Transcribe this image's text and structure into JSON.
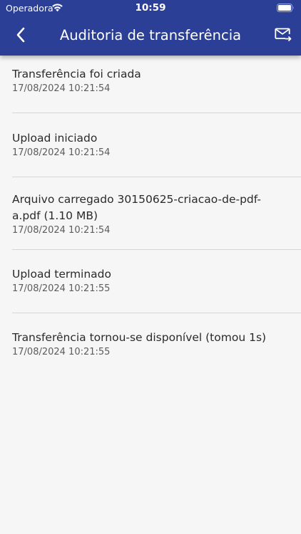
{
  "status_bar": {
    "carrier": "Operadora",
    "time": "10:59"
  },
  "nav": {
    "title": "Auditoria de transferência",
    "back_icon": "chevron-left-icon",
    "mail_icon": "mail-forward-icon"
  },
  "colors": {
    "header": "#2c3f96",
    "background": "#f6f6f6",
    "divider": "#d6d6d6"
  },
  "events": [
    {
      "title": "Transferência foi criada",
      "time": "17/08/2024 10:21:54"
    },
    {
      "title": "Upload iniciado",
      "time": "17/08/2024 10:21:54"
    },
    {
      "title": "Arquivo carregado 30150625-criacao-de-pdf-a.pdf (1.10 MB)",
      "time": "17/08/2024 10:21:54"
    },
    {
      "title": "Upload terminado",
      "time": "17/08/2024 10:21:55"
    },
    {
      "title": "Transferência tornou-se disponível (tomou 1s)",
      "time": "17/08/2024 10:21:55"
    }
  ]
}
